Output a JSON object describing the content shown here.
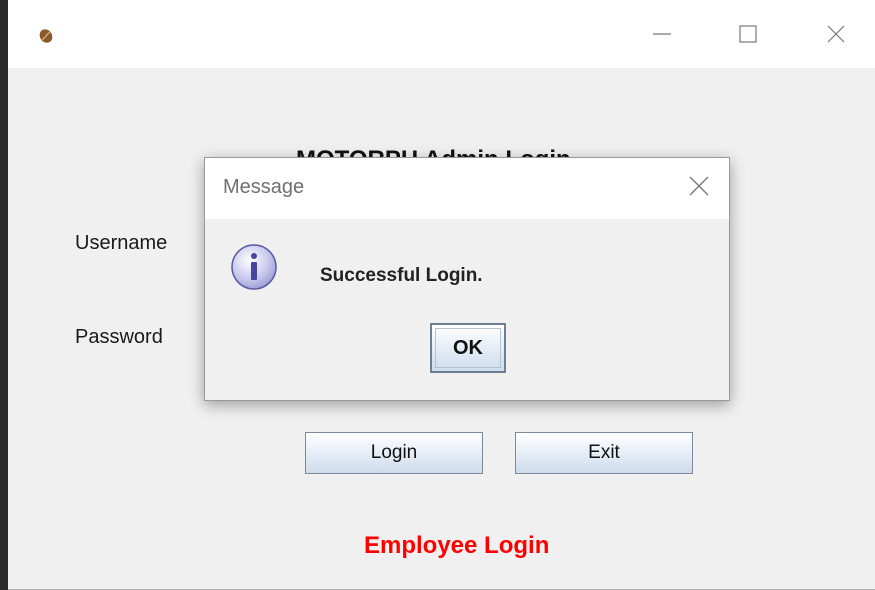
{
  "window": {
    "icon": "coffee-bean-icon",
    "controls": {
      "minimize": "minimize-icon",
      "maximize": "maximize-icon",
      "close": "close-icon"
    }
  },
  "form": {
    "heading": "MOTORPH Admin Login",
    "username_label": "Username",
    "password_label": "Password",
    "login_label": "Login",
    "exit_label": "Exit",
    "employee_login": "Employee Login"
  },
  "dialog": {
    "title": "Message",
    "message": "Successful Login.",
    "ok_label": "OK",
    "icon": "info-icon",
    "close_icon": "close-icon"
  },
  "colors": {
    "accent_red": "#ff0000",
    "panel_bg": "#f0f0f0"
  }
}
